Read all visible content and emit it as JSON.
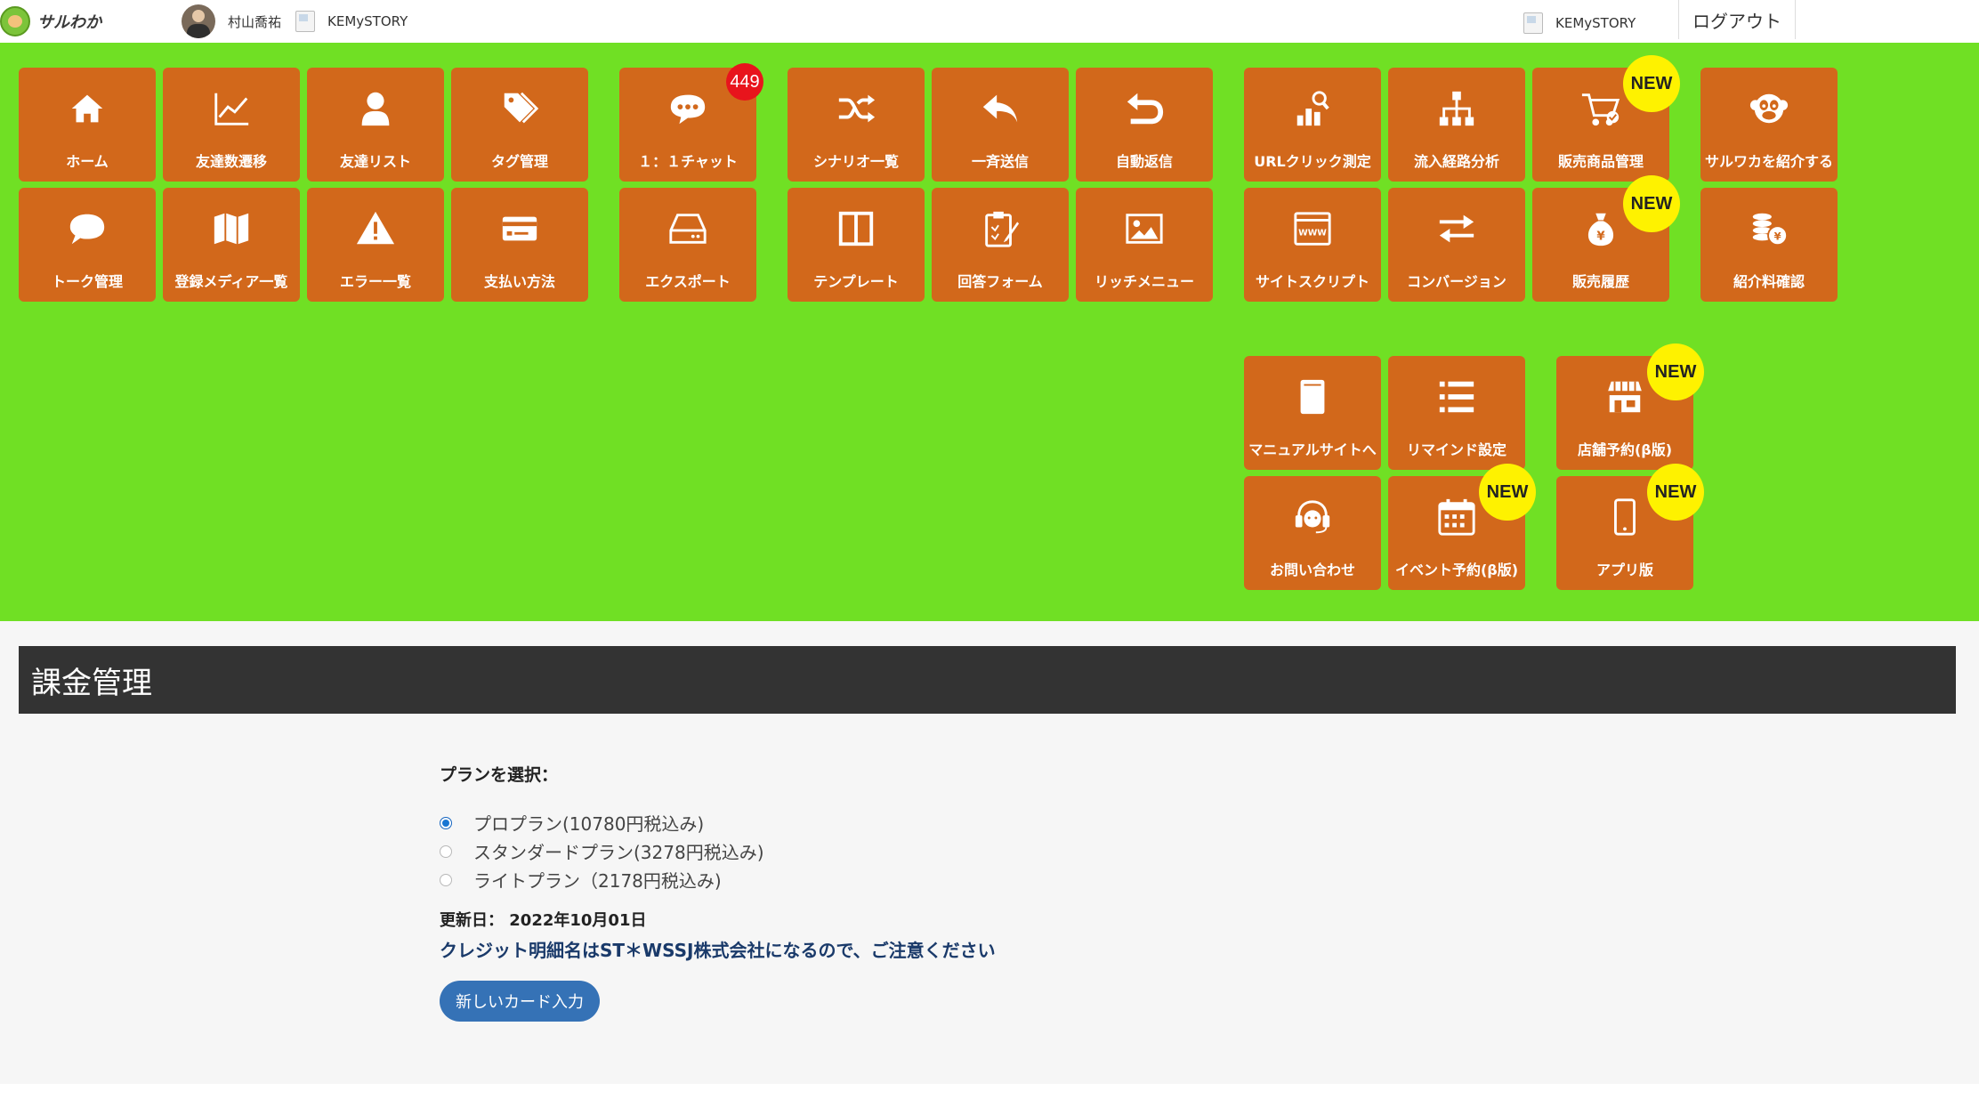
{
  "header": {
    "logo_text": "サルわか",
    "user_name": "村山喬祐",
    "account_left": "KEMySTORY",
    "account_right": "KEMySTORY",
    "logout": "ログアウト"
  },
  "menu": {
    "home": "ホーム",
    "friend_growth": "友達数遷移",
    "friend_list": "友達リスト",
    "tag_manage": "タグ管理",
    "chat": "１：１チャット",
    "chat_count": "449",
    "scenario_list": "シナリオ一覧",
    "broadcast": "一斉送信",
    "auto_reply": "自動返信",
    "url_click": "URLクリック測定",
    "traffic_analysis": "流入経路分析",
    "product_manage": "販売商品管理",
    "introduce": "サルワカを紹介する",
    "talk_manage": "トーク管理",
    "media_list": "登録メディア一覧",
    "error_list": "エラー一覧",
    "payment_method": "支払い方法",
    "export": "エクスポート",
    "template": "テンプレート",
    "answer_form": "回答フォーム",
    "rich_menu": "リッチメニュー",
    "site_script": "サイトスクリプト",
    "conversion": "コンバージョン",
    "sales_history": "販売履歴",
    "referral_check": "紹介料確認",
    "manual_site": "マニュアルサイトへ",
    "remind": "リマインド設定",
    "store_reservation": "店舗予約(β版)",
    "contact": "お問い合わせ",
    "event_reservation": "イベント予約(β版)",
    "app": "アプリ版",
    "new_badge": "NEW"
  },
  "billing": {
    "title": "課金管理",
    "plan_heading": "プランを選択：",
    "plans": [
      {
        "label": "プロプラン(10780円税込み)",
        "selected": true
      },
      {
        "label": "スタンダードプラン(3278円税込み)",
        "selected": false
      },
      {
        "label": "ライトプラン（2178円税込み)",
        "selected": false
      }
    ],
    "updated_label": "更新日：",
    "updated_value": "2022年10月01日",
    "notice": "クレジット明細名はST＊WSSJ株式会社になるので、ご注意ください",
    "button": "新しいカード入力"
  },
  "colors": {
    "menu_bg": "#70e024",
    "tile": "#d2681b",
    "new_badge": "#fef200",
    "count_badge": "#e8141c",
    "section_bar": "#333333",
    "button": "#3572b6"
  }
}
